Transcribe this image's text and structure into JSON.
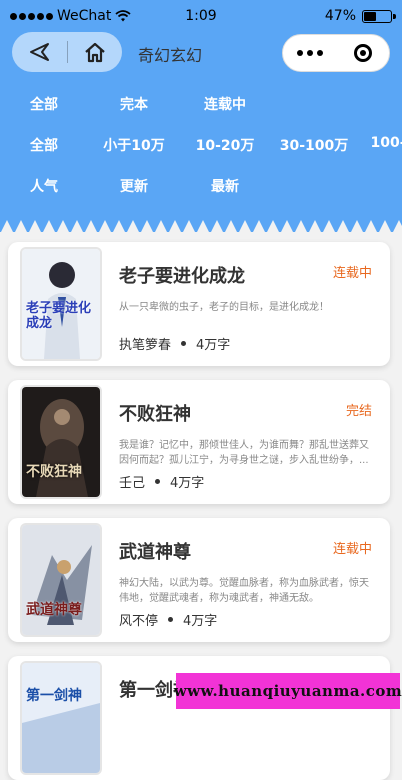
{
  "status_bar": {
    "carrier": "WeChat",
    "time": "1:09",
    "battery": "47%",
    "battery_level": 0.47
  },
  "nav": {
    "title": "奇幻玄幻"
  },
  "filters": {
    "status": [
      "全部",
      "完本",
      "连载中"
    ],
    "words": [
      "全部",
      "小于10万",
      "10-20万",
      "30-100万",
      "100-"
    ],
    "sort": [
      "人气",
      "更新",
      "最新"
    ]
  },
  "books": [
    {
      "title": "老子要进化成龙",
      "status": "连载中",
      "desc": "从一只卑微的虫子，老子的目标，是进化成龙！",
      "author": "执笔箩春",
      "words": "4万字",
      "cover_text": "老子要进化成龙"
    },
    {
      "title": "不败狂神",
      "status": "完结",
      "desc": "我是谁？记忆中，那倾世佳人，为谁而舞？那乱世送葬又因何而起？孤儿江宁，为寻身世之谜，步入乱世纷争，...",
      "author": "壬己",
      "words": "4万字",
      "cover_text": "不败狂神"
    },
    {
      "title": "武道神尊",
      "status": "连载中",
      "desc": "神幻大陆，以武为尊。觉醒血脉者，称为血脉武者，惊天伟地，觉醒武魂者，称为魂武者，神通无敌。",
      "author": "风不停",
      "words": "4万字",
      "cover_text": "武道神尊"
    },
    {
      "title": "第一剑神",
      "status": "",
      "desc": "",
      "author": "",
      "words": "",
      "cover_text": "第一剑神"
    }
  ],
  "watermark": "www.huanqiuyuanma.com",
  "colors": {
    "header_bg": "#5aa6f5",
    "status_orange": "#e8681f",
    "watermark_bg": "#f233d6"
  }
}
